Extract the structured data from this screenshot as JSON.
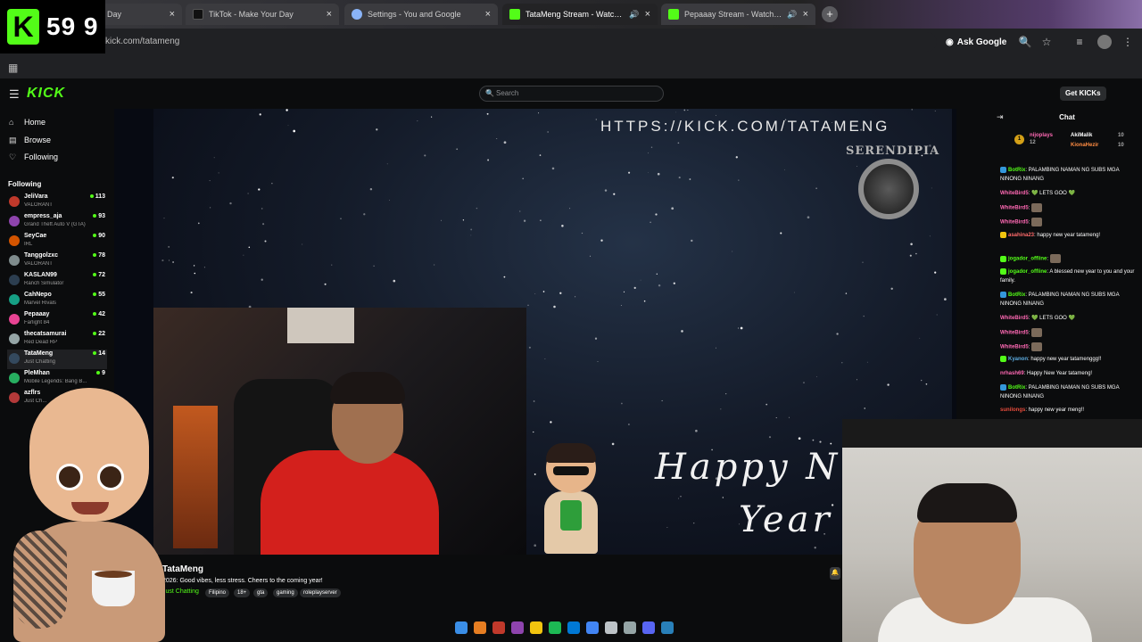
{
  "browser": {
    "tabs": [
      {
        "label": "Day",
        "icon": "tiktok-icon",
        "color": "#1a1a1a",
        "close": "×"
      },
      {
        "label": "TikTok - Make Your Day",
        "icon": "tiktok-icon",
        "color": "#111111",
        "close": "×"
      },
      {
        "label": "Settings - You and Google",
        "icon": "gear-icon",
        "color": "#8ab4f8",
        "close": "×"
      },
      {
        "label": "TataMeng Stream - Watch Li...",
        "icon": "kick-icon",
        "color": "#53fc18",
        "close": "×"
      },
      {
        "label": "Pepaaay Stream - Watch Live",
        "icon": "kick-icon",
        "color": "#53fc18",
        "close": "×"
      }
    ],
    "new_tab": "+",
    "url": "kick.com/tatameng",
    "ask_google": "Ask Google"
  },
  "timer": {
    "value": "59 9",
    "badge": "K"
  },
  "kick": {
    "logo": "KICK",
    "search_placeholder": "Search",
    "get_kicks": "Get KICKs",
    "nav": [
      {
        "label": "Home",
        "icon": "home-icon"
      },
      {
        "label": "Browse",
        "icon": "browse-icon"
      },
      {
        "label": "Following",
        "icon": "heart-icon"
      }
    ],
    "following_title": "Following",
    "channels": [
      {
        "name": "JeliVara",
        "game": "VALORANT",
        "viewers": "113",
        "color": "#c0392b"
      },
      {
        "name": "empress_aja",
        "game": "Grand Theft Auto V (GTA)",
        "viewers": "93",
        "color": "#8e44ad"
      },
      {
        "name": "SeyCae",
        "game": "IRL",
        "viewers": "90",
        "color": "#d35400"
      },
      {
        "name": "Tanggolzxc",
        "game": "VALORANT",
        "viewers": "78",
        "color": "#7f8c8d"
      },
      {
        "name": "KASLAN99",
        "game": "Ranch Simulator",
        "viewers": "72",
        "color": "#2c3e50"
      },
      {
        "name": "CahNepo",
        "game": "Marvel Rivals",
        "viewers": "55",
        "color": "#16a085"
      },
      {
        "name": "Pepaaay",
        "game": "Farlight 84",
        "viewers": "42",
        "color": "#e84393"
      },
      {
        "name": "thecatsamurai",
        "game": "Red Dead RP",
        "viewers": "22",
        "color": "#95a5a6"
      },
      {
        "name": "TataMeng",
        "game": "Just Chatting",
        "viewers": "14",
        "color": "#34495e"
      },
      {
        "name": "PleMhan",
        "game": "Mobile Legends: Bang B...",
        "viewers": "9",
        "color": "#27ae60"
      },
      {
        "name": "azflrs",
        "game": "Just Ch...",
        "viewers": "9",
        "color": "#b33939"
      }
    ]
  },
  "stream": {
    "overlay_url": "HTTPS://KICK.COM/TATAMENG",
    "logo_text": "SERENDIPIA",
    "happy_line1": "Happy N",
    "happy_line2": "Year",
    "streamer": "TataMeng",
    "title": "2026: Good vibes, less stress. Cheers to the coming year!",
    "category": "Just Chatting",
    "tags": [
      "Filipino",
      "18+",
      "gta",
      "gaming",
      "roleplayserver"
    ]
  },
  "chat": {
    "title": "Chat",
    "pinned": [
      {
        "user": "nijoplays",
        "value": "12",
        "color": "#ff69b4"
      },
      {
        "user": "AkiMalik",
        "value": "10",
        "color": "#ffffff"
      },
      {
        "user": "KionaHezir",
        "value": "10",
        "color": "#ff8c42"
      }
    ],
    "pinned_badge": "1",
    "messages": [
      {
        "user": "BotRix",
        "text": ": PALAMBING NAMAN NG SUBS MGA NINONG NINANG",
        "color": "#53fc18",
        "badge": "#3498db"
      },
      {
        "user": "WhiteBird5",
        "text": ": 💚 LETS GOO 💚",
        "color": "#ff69b4",
        "badge": ""
      },
      {
        "user": "WhiteBird5",
        "text": ":",
        "color": "#ff69b4",
        "badge": ""
      },
      {
        "user": "WhiteBird5",
        "text": ":",
        "color": "#ff69b4",
        "badge": ""
      },
      {
        "user": "asahina23",
        "text": ": happy new year tatameng!",
        "color": "#ff6b6b",
        "badge": "#f1c40f"
      },
      {
        "user": "jogador_offline",
        "text": ":",
        "color": "#53fc18",
        "badge": "#53fc18"
      },
      {
        "user": "jogador_offline",
        "text": ": A blessed new year to you and your family.",
        "color": "#53fc18",
        "badge": "#53fc18"
      },
      {
        "user": "BotRix",
        "text": ": PALAMBING NAMAN NG SUBS MGA NINONG NINANG",
        "color": "#53fc18",
        "badge": "#3498db"
      },
      {
        "user": "WhiteBird5",
        "text": ": 💚 LETS GOO 💚",
        "color": "#ff69b4",
        "badge": ""
      },
      {
        "user": "WhiteBird5",
        "text": ":",
        "color": "#ff69b4",
        "badge": ""
      },
      {
        "user": "WhiteBird5",
        "text": ":",
        "color": "#ff69b4",
        "badge": ""
      },
      {
        "user": "Kyanon",
        "text": ": happy new year tatamenggg!!",
        "color": "#5dade2",
        "badge": "#53fc18"
      },
      {
        "user": "nrhash69",
        "text": ": Happy New Year tatameng!",
        "color": "#ff69b4",
        "badge": ""
      },
      {
        "user": "BotRix",
        "text": ": PALAMBING NAMAN NG SUBS MGA NINONG NINANG",
        "color": "#53fc18",
        "badge": "#3498db"
      },
      {
        "user": "sunilongs",
        "text": ": happy new year meng!!",
        "color": "#e74c3c",
        "badge": ""
      }
    ]
  },
  "taskbar": [
    "windows-icon",
    "orange-app-icon",
    "red-app-icon",
    "purple-app-icon",
    "folder-icon",
    "spotify-icon",
    "edge-icon",
    "chrome-icon",
    "notepad-icon",
    "settings-icon",
    "discord-icon",
    "photo-icon"
  ]
}
